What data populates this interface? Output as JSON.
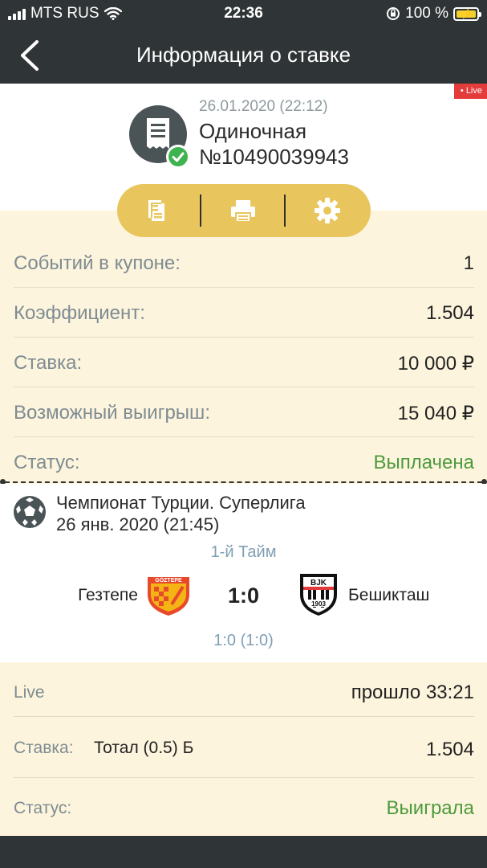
{
  "status_bar": {
    "carrier": "MTS RUS",
    "time": "22:36",
    "battery": "100 %",
    "icons": [
      "signal-icon",
      "wifi-icon",
      "orientation-lock-icon",
      "battery-charging-icon"
    ]
  },
  "header": {
    "back_icon": "chevron-left-icon",
    "title": "Информация о ставке"
  },
  "bet": {
    "live_badge": "• Live",
    "date": "26.01.2020 (22:12)",
    "type": "Одиночная",
    "number": "№10490039943",
    "icon": "receipt-icon",
    "status_icon": "check-circle-icon"
  },
  "actions": [
    {
      "icon": "document-icon"
    },
    {
      "icon": "printer-icon"
    },
    {
      "icon": "gear-icon"
    }
  ],
  "summary": [
    {
      "label": "Событий в купоне:",
      "value": "1"
    },
    {
      "label": "Коэффициент:",
      "value": "1.504"
    },
    {
      "label": "Ставка:",
      "value": "10 000 ₽"
    },
    {
      "label": "Возможный выигрыш:",
      "value": "15 040 ₽"
    },
    {
      "label": "Статус:",
      "value": "Выплачена"
    }
  ],
  "match": {
    "sport_icon": "soccer-ball-icon",
    "league": "Чемпионат Турции. Суперлига",
    "date": "26 янв. 2020 (21:45)",
    "period": "1-й Тайм",
    "team1": "Гезтепе",
    "team1_logo_text": "GÖZTEPE",
    "score": "1:0",
    "team2": "Бешикташ",
    "team2_logo_text": "BJK",
    "team2_logo_year": "1903",
    "half_score": "1:0 (1:0)"
  },
  "event": {
    "live_label": "Live",
    "elapsed": "прошло 33:21",
    "bet_label": "Ставка:",
    "bet_market": "Тотал (0.5) Б",
    "coef": "1.504",
    "status_label": "Статус:",
    "status_value": "Выиграла"
  },
  "colors": {
    "dark": "#2f3436",
    "cream": "#fdf4dd",
    "accent": "#e9c65d",
    "green": "#4c9a3c",
    "live_red": "#e43b3b",
    "muted_blue": "#7f9fb3"
  }
}
